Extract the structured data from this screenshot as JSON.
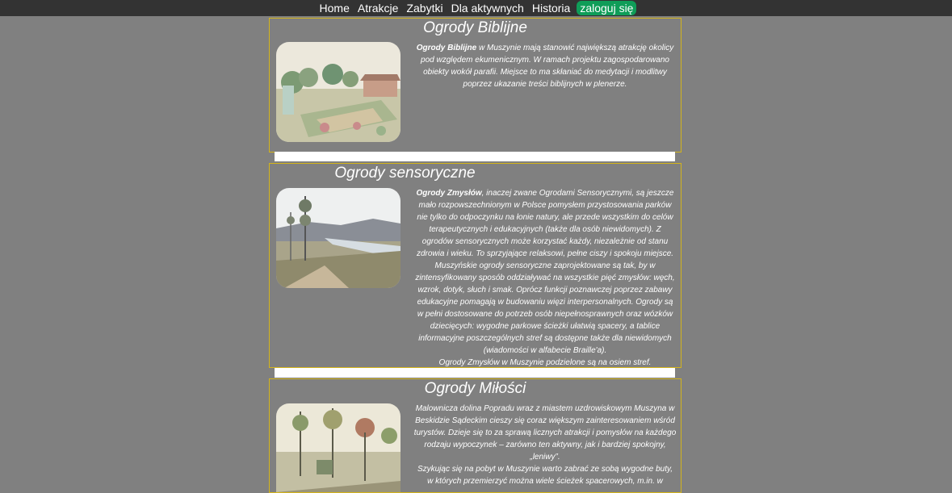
{
  "nav": {
    "home": "Home",
    "atrakcje": "Atrakcje",
    "zabytki": "Zabytki",
    "dla_aktywnych": "Dla aktywnych",
    "historia": "Historia",
    "login": "zaloguj się"
  },
  "colors": {
    "page_bg": "#808080",
    "nav_bg": "#333333",
    "login_bg": "#0f9d58",
    "card_border": "#d4b41a"
  },
  "cards": [
    {
      "title": "Ogrody Biblijne",
      "lead": "Ogrody Biblijne",
      "text": " w Muszynie mają stanowić największą atrakcję okolicy pod względem ekumenicznym. W ramach projektu zagospodarowano obiekty wokół parafii. Miejsce to ma skłaniać do medytacji i modlitwy poprzez ukazanie treści biblijnych w plenerze."
    },
    {
      "title": "Ogrody sensoryczne",
      "lead": "Ogrody Zmysłów",
      "text": ", inaczej zwane Ogrodami Sensorycznymi, są jeszcze mało rozpowszechnionym w Polsce pomysłem przystosowania parków nie tylko do odpoczynku na łonie natury, ale przede wszystkim do celów terapeutycznych i edukacyjnych (także dla osób niewidomych). Z ogrodów sensorycznych może korzystać każdy, niezależnie od stanu zdrowia i wieku. To sprzyjające relaksowi, pełne ciszy i spokoju miejsce. Muszyńskie ogrody sensoryczne zaprojektowane są tak, by w zintensyfikowany sposób oddziaływać na wszystkie pięć zmysłów: węch, wzrok, dotyk, słuch i smak. Oprócz funkcji poznawczej poprzez zabawy edukacyjne pomagają w budowaniu więzi interpersonalnych. Ogrody są w pełni dostosowane do potrzeb osób niepełnosprawnych oraz wózków dziecięcych: wygodne parkowe ścieżki ułatwią spacery, a tablice informacyjne poszczególnych stref są dostępne także dla niewidomych (wiadomości w alfabecie Braille'a).",
      "text2": "Ogrody Zmysłów w Muszynie podzielone są na osiem stref."
    },
    {
      "title": "Ogrody Miłości",
      "text": "Malownicza dolina Popradu wraz z miastem uzdrowiskowym Muszyna w Beskidzie Sądeckim cieszy się coraz większym zainteresowaniem wśród turystów. Dzieje się to za sprawą licznych atrakcji i pomysłów na każdego rodzaju wypoczynek – zarówno ten aktywny, jak i bardziej spokojny, „leniwy”.",
      "text2": "Szykując się na pobyt w Muszynie warto zabrać ze sobą wygodne buty, w których przemierzyć można wiele ścieżek spacerowych, m.in. w"
    }
  ]
}
